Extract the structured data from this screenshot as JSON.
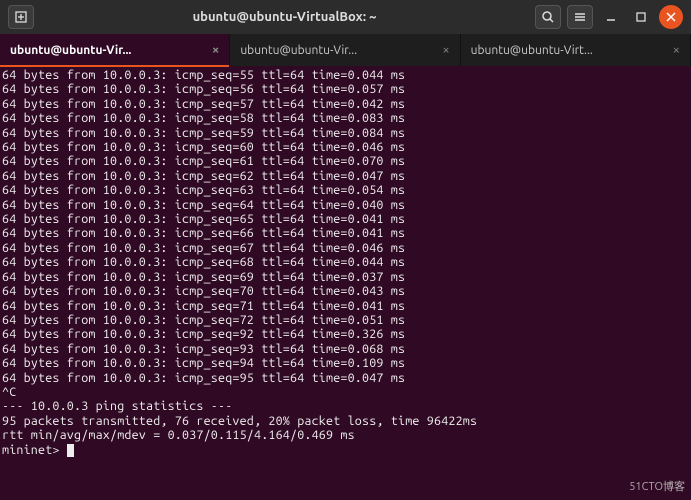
{
  "titlebar": {
    "title": "ubuntu@ubuntu-VirtualBox: ~"
  },
  "tabs": [
    {
      "label": "ubuntu@ubuntu-Vir...",
      "active": true
    },
    {
      "label": "ubuntu@ubuntu-Vir...",
      "active": false
    },
    {
      "label": "ubuntu@ubuntu-Virt...",
      "active": false
    }
  ],
  "ping": {
    "host": "10.0.0.3",
    "bytes": 64,
    "ttl": 64,
    "lines": [
      {
        "seq": 55,
        "time": "0.044"
      },
      {
        "seq": 56,
        "time": "0.057"
      },
      {
        "seq": 57,
        "time": "0.042"
      },
      {
        "seq": 58,
        "time": "0.083"
      },
      {
        "seq": 59,
        "time": "0.084"
      },
      {
        "seq": 60,
        "time": "0.046"
      },
      {
        "seq": 61,
        "time": "0.070"
      },
      {
        "seq": 62,
        "time": "0.047"
      },
      {
        "seq": 63,
        "time": "0.054"
      },
      {
        "seq": 64,
        "time": "0.040"
      },
      {
        "seq": 65,
        "time": "0.041"
      },
      {
        "seq": 66,
        "time": "0.041"
      },
      {
        "seq": 67,
        "time": "0.046"
      },
      {
        "seq": 68,
        "time": "0.044"
      },
      {
        "seq": 69,
        "time": "0.037"
      },
      {
        "seq": 70,
        "time": "0.043"
      },
      {
        "seq": 71,
        "time": "0.041"
      },
      {
        "seq": 72,
        "time": "0.051"
      },
      {
        "seq": 92,
        "time": "0.326"
      },
      {
        "seq": 93,
        "time": "0.068"
      },
      {
        "seq": 94,
        "time": "0.109"
      },
      {
        "seq": 95,
        "time": "0.047"
      }
    ],
    "interrupt": "^C",
    "stats_header": "--- 10.0.0.3 ping statistics ---",
    "stats_line1": "95 packets transmitted, 76 received, 20% packet loss, time 96422ms",
    "stats_line2": "rtt min/avg/max/mdev = 0.037/0.115/4.164/0.469 ms",
    "prompt": "mininet> "
  },
  "watermark": "51CTO博客"
}
